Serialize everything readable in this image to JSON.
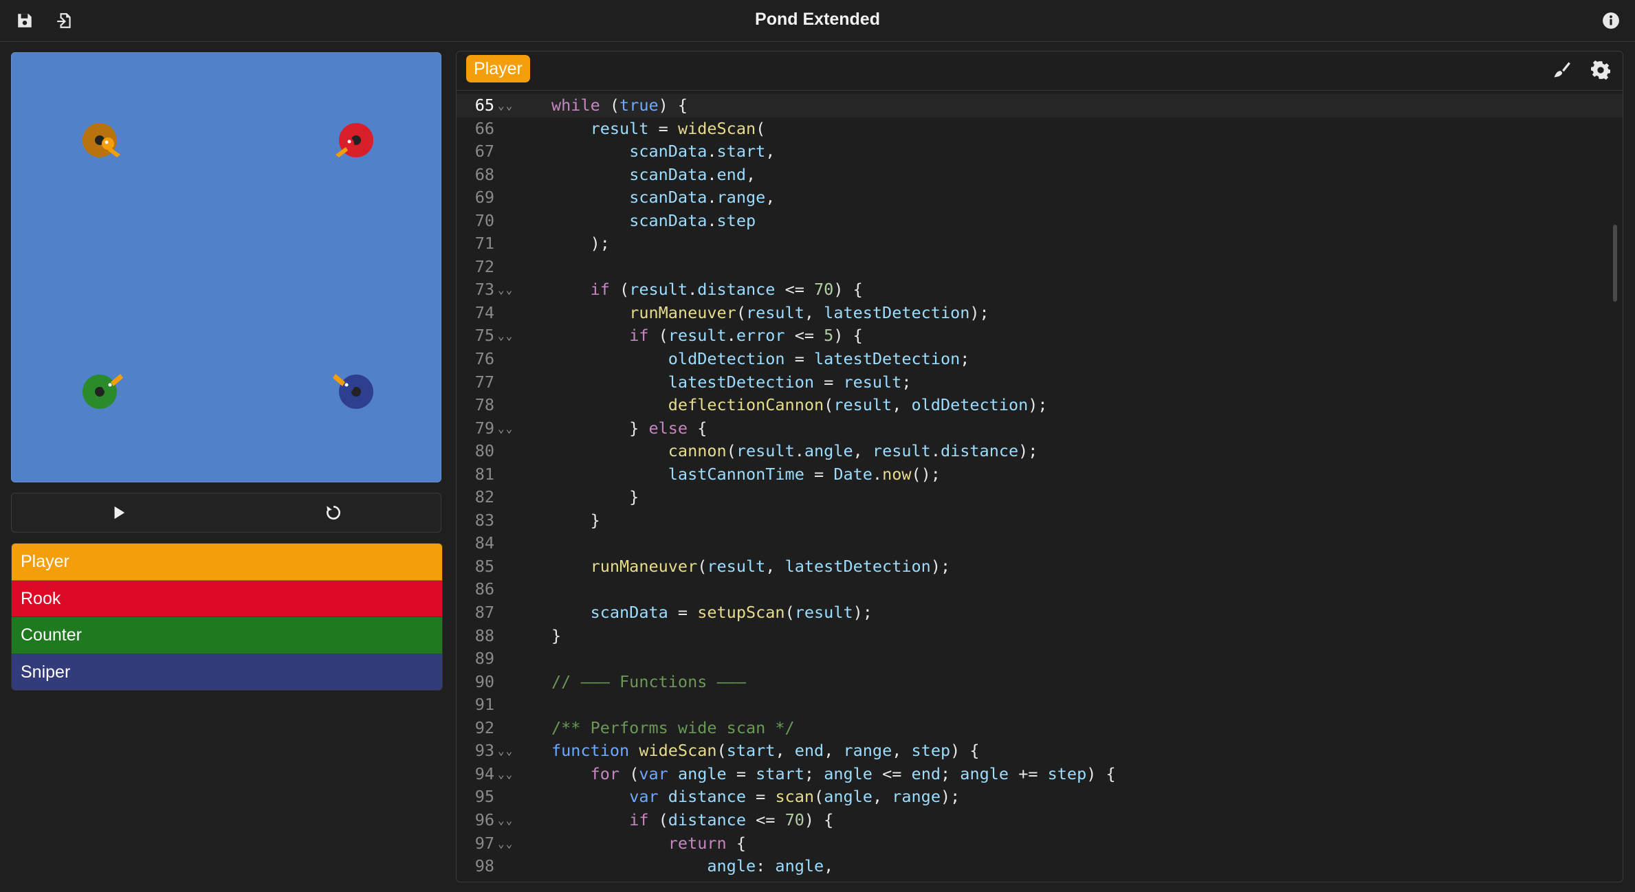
{
  "app": {
    "title": "Pond Extended"
  },
  "toolbar": {
    "save_icon": "save-icon",
    "import_icon": "import-icon",
    "info_icon": "info-icon"
  },
  "pond": {
    "background": "#5181c8",
    "ducks": [
      {
        "name": "Player",
        "color": "#b8730f"
      },
      {
        "name": "Rook",
        "color": "#d9202a"
      },
      {
        "name": "Counter",
        "color": "#2b8a2b"
      },
      {
        "name": "Sniper",
        "color": "#2f3f8f"
      }
    ]
  },
  "controls": {
    "play_icon": "play-icon",
    "reset_icon": "reset-icon"
  },
  "roster": [
    {
      "label": "Player",
      "color": "#f59e0b"
    },
    {
      "label": "Rook",
      "color": "#dc0a26"
    },
    {
      "label": "Counter",
      "color": "#1f7a1f"
    },
    {
      "label": "Sniper",
      "color": "#343b7a"
    }
  ],
  "editor": {
    "tab_label": "Player",
    "brush_icon": "brush-icon",
    "settings_icon": "gear-icon",
    "active_line": 65,
    "lines": [
      {
        "n": "65",
        "fold": true,
        "tokens": [
          [
            "kw",
            "while"
          ],
          [
            "pl",
            " ("
          ],
          [
            "kw2",
            "true"
          ],
          [
            "pl",
            ") {"
          ]
        ]
      },
      {
        "n": "66",
        "fold": false,
        "tokens": [
          [
            "pl",
            "    "
          ],
          [
            "id",
            "result"
          ],
          [
            "pl",
            " = "
          ],
          [
            "fn",
            "wideScan"
          ],
          [
            "pl",
            "("
          ]
        ]
      },
      {
        "n": "67",
        "fold": false,
        "tokens": [
          [
            "pl",
            "        "
          ],
          [
            "id",
            "scanData"
          ],
          [
            "pl",
            "."
          ],
          [
            "id",
            "start"
          ],
          [
            "pl",
            ","
          ]
        ]
      },
      {
        "n": "68",
        "fold": false,
        "tokens": [
          [
            "pl",
            "        "
          ],
          [
            "id",
            "scanData"
          ],
          [
            "pl",
            "."
          ],
          [
            "id",
            "end"
          ],
          [
            "pl",
            ","
          ]
        ]
      },
      {
        "n": "69",
        "fold": false,
        "tokens": [
          [
            "pl",
            "        "
          ],
          [
            "id",
            "scanData"
          ],
          [
            "pl",
            "."
          ],
          [
            "id",
            "range"
          ],
          [
            "pl",
            ","
          ]
        ]
      },
      {
        "n": "70",
        "fold": false,
        "tokens": [
          [
            "pl",
            "        "
          ],
          [
            "id",
            "scanData"
          ],
          [
            "pl",
            "."
          ],
          [
            "id",
            "step"
          ]
        ]
      },
      {
        "n": "71",
        "fold": false,
        "tokens": [
          [
            "pl",
            "    );"
          ]
        ]
      },
      {
        "n": "72",
        "fold": false,
        "tokens": []
      },
      {
        "n": "73",
        "fold": true,
        "tokens": [
          [
            "pl",
            "    "
          ],
          [
            "kw",
            "if"
          ],
          [
            "pl",
            " ("
          ],
          [
            "id",
            "result"
          ],
          [
            "pl",
            "."
          ],
          [
            "id",
            "distance"
          ],
          [
            "pl",
            " <= "
          ],
          [
            "num",
            "70"
          ],
          [
            "pl",
            ") {"
          ]
        ]
      },
      {
        "n": "74",
        "fold": false,
        "tokens": [
          [
            "pl",
            "        "
          ],
          [
            "fn",
            "runManeuver"
          ],
          [
            "pl",
            "("
          ],
          [
            "id",
            "result"
          ],
          [
            "pl",
            ", "
          ],
          [
            "id",
            "latestDetection"
          ],
          [
            "pl",
            ");"
          ]
        ]
      },
      {
        "n": "75",
        "fold": true,
        "tokens": [
          [
            "pl",
            "        "
          ],
          [
            "kw",
            "if"
          ],
          [
            "pl",
            " ("
          ],
          [
            "id",
            "result"
          ],
          [
            "pl",
            "."
          ],
          [
            "id",
            "error"
          ],
          [
            "pl",
            " <= "
          ],
          [
            "num",
            "5"
          ],
          [
            "pl",
            ") {"
          ]
        ]
      },
      {
        "n": "76",
        "fold": false,
        "tokens": [
          [
            "pl",
            "            "
          ],
          [
            "id",
            "oldDetection"
          ],
          [
            "pl",
            " = "
          ],
          [
            "id",
            "latestDetection"
          ],
          [
            "pl",
            ";"
          ]
        ]
      },
      {
        "n": "77",
        "fold": false,
        "tokens": [
          [
            "pl",
            "            "
          ],
          [
            "id",
            "latestDetection"
          ],
          [
            "pl",
            " = "
          ],
          [
            "id",
            "result"
          ],
          [
            "pl",
            ";"
          ]
        ]
      },
      {
        "n": "78",
        "fold": false,
        "tokens": [
          [
            "pl",
            "            "
          ],
          [
            "fn",
            "deflectionCannon"
          ],
          [
            "pl",
            "("
          ],
          [
            "id",
            "result"
          ],
          [
            "pl",
            ", "
          ],
          [
            "id",
            "oldDetection"
          ],
          [
            "pl",
            ");"
          ]
        ]
      },
      {
        "n": "79",
        "fold": true,
        "tokens": [
          [
            "pl",
            "        } "
          ],
          [
            "kw",
            "else"
          ],
          [
            "pl",
            " {"
          ]
        ]
      },
      {
        "n": "80",
        "fold": false,
        "tokens": [
          [
            "pl",
            "            "
          ],
          [
            "fn",
            "cannon"
          ],
          [
            "pl",
            "("
          ],
          [
            "id",
            "result"
          ],
          [
            "pl",
            "."
          ],
          [
            "id",
            "angle"
          ],
          [
            "pl",
            ", "
          ],
          [
            "id",
            "result"
          ],
          [
            "pl",
            "."
          ],
          [
            "id",
            "distance"
          ],
          [
            "pl",
            ");"
          ]
        ]
      },
      {
        "n": "81",
        "fold": false,
        "tokens": [
          [
            "pl",
            "            "
          ],
          [
            "id",
            "lastCannonTime"
          ],
          [
            "pl",
            " = "
          ],
          [
            "id",
            "Date"
          ],
          [
            "pl",
            "."
          ],
          [
            "fn",
            "now"
          ],
          [
            "pl",
            "();"
          ]
        ]
      },
      {
        "n": "82",
        "fold": false,
        "tokens": [
          [
            "pl",
            "        }"
          ]
        ]
      },
      {
        "n": "83",
        "fold": false,
        "tokens": [
          [
            "pl",
            "    }"
          ]
        ]
      },
      {
        "n": "84",
        "fold": false,
        "tokens": []
      },
      {
        "n": "85",
        "fold": false,
        "tokens": [
          [
            "pl",
            "    "
          ],
          [
            "fn",
            "runManeuver"
          ],
          [
            "pl",
            "("
          ],
          [
            "id",
            "result"
          ],
          [
            "pl",
            ", "
          ],
          [
            "id",
            "latestDetection"
          ],
          [
            "pl",
            ");"
          ]
        ]
      },
      {
        "n": "86",
        "fold": false,
        "tokens": []
      },
      {
        "n": "87",
        "fold": false,
        "tokens": [
          [
            "pl",
            "    "
          ],
          [
            "id",
            "scanData"
          ],
          [
            "pl",
            " = "
          ],
          [
            "fn",
            "setupScan"
          ],
          [
            "pl",
            "("
          ],
          [
            "id",
            "result"
          ],
          [
            "pl",
            ");"
          ]
        ]
      },
      {
        "n": "88",
        "fold": false,
        "tokens": [
          [
            "pl",
            "}"
          ]
        ]
      },
      {
        "n": "89",
        "fold": false,
        "tokens": []
      },
      {
        "n": "90",
        "fold": false,
        "tokens": [
          [
            "cm",
            "// ——— Functions ———"
          ]
        ]
      },
      {
        "n": "91",
        "fold": false,
        "tokens": []
      },
      {
        "n": "92",
        "fold": false,
        "tokens": [
          [
            "cm",
            "/** Performs wide scan */"
          ]
        ]
      },
      {
        "n": "93",
        "fold": true,
        "tokens": [
          [
            "kw2",
            "function"
          ],
          [
            "pl",
            " "
          ],
          [
            "fn",
            "wideScan"
          ],
          [
            "pl",
            "("
          ],
          [
            "id",
            "start"
          ],
          [
            "pl",
            ", "
          ],
          [
            "id",
            "end"
          ],
          [
            "pl",
            ", "
          ],
          [
            "id",
            "range"
          ],
          [
            "pl",
            ", "
          ],
          [
            "id",
            "step"
          ],
          [
            "pl",
            ") {"
          ]
        ]
      },
      {
        "n": "94",
        "fold": true,
        "tokens": [
          [
            "pl",
            "    "
          ],
          [
            "kw",
            "for"
          ],
          [
            "pl",
            " ("
          ],
          [
            "kw2",
            "var"
          ],
          [
            "pl",
            " "
          ],
          [
            "id",
            "angle"
          ],
          [
            "pl",
            " = "
          ],
          [
            "id",
            "start"
          ],
          [
            "pl",
            "; "
          ],
          [
            "id",
            "angle"
          ],
          [
            "pl",
            " <= "
          ],
          [
            "id",
            "end"
          ],
          [
            "pl",
            "; "
          ],
          [
            "id",
            "angle"
          ],
          [
            "pl",
            " += "
          ],
          [
            "id",
            "step"
          ],
          [
            "pl",
            ") {"
          ]
        ]
      },
      {
        "n": "95",
        "fold": false,
        "tokens": [
          [
            "pl",
            "        "
          ],
          [
            "kw2",
            "var"
          ],
          [
            "pl",
            " "
          ],
          [
            "id",
            "distance"
          ],
          [
            "pl",
            " = "
          ],
          [
            "fn",
            "scan"
          ],
          [
            "pl",
            "("
          ],
          [
            "id",
            "angle"
          ],
          [
            "pl",
            ", "
          ],
          [
            "id",
            "range"
          ],
          [
            "pl",
            ");"
          ]
        ]
      },
      {
        "n": "96",
        "fold": true,
        "tokens": [
          [
            "pl",
            "        "
          ],
          [
            "kw",
            "if"
          ],
          [
            "pl",
            " ("
          ],
          [
            "id",
            "distance"
          ],
          [
            "pl",
            " <= "
          ],
          [
            "num",
            "70"
          ],
          [
            "pl",
            ") {"
          ]
        ]
      },
      {
        "n": "97",
        "fold": true,
        "tokens": [
          [
            "pl",
            "            "
          ],
          [
            "kw",
            "return"
          ],
          [
            "pl",
            " {"
          ]
        ]
      },
      {
        "n": "98",
        "fold": false,
        "tokens": [
          [
            "pl",
            "                "
          ],
          [
            "id",
            "angle"
          ],
          [
            "pl",
            ": "
          ],
          [
            "id",
            "angle"
          ],
          [
            "pl",
            ","
          ]
        ]
      }
    ]
  }
}
